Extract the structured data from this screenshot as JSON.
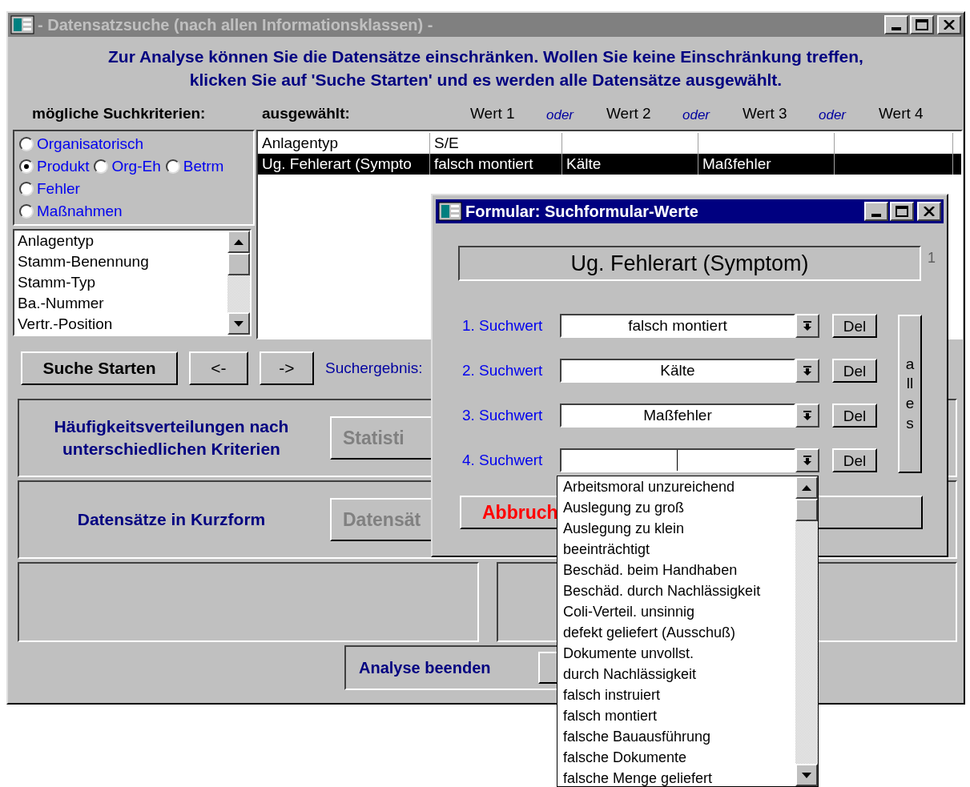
{
  "window": {
    "title": "- Datensatzsuche (nach allen Informationsklassen) -",
    "active": false
  },
  "instructions": [
    "Zur Analyse können Sie die Datensätze einschränken. Wollen Sie keine Einschränkung treffen,",
    "klicken Sie auf 'Suche Starten' und es werden alle Datensätze ausgewählt."
  ],
  "criteria_label": "mögliche Suchkriterien:",
  "selected_label": "ausgewählt:",
  "value_headers": [
    {
      "text": "Wert 1",
      "kind": "value"
    },
    {
      "text": "oder",
      "kind": "connector"
    },
    {
      "text": "Wert 2",
      "kind": "value"
    },
    {
      "text": "oder",
      "kind": "connector"
    },
    {
      "text": "Wert 3",
      "kind": "value"
    },
    {
      "text": "oder",
      "kind": "connector"
    },
    {
      "text": "Wert 4",
      "kind": "value"
    }
  ],
  "categories": [
    [
      {
        "label": "Organisatorisch",
        "selected": false
      }
    ],
    [
      {
        "label": "Produkt",
        "selected": true
      },
      {
        "label": "Org-Eh",
        "selected": false
      },
      {
        "label": "Betrm",
        "selected": false
      }
    ],
    [
      {
        "label": "Fehler",
        "selected": false
      }
    ],
    [
      {
        "label": "Maßnahmen",
        "selected": false
      }
    ]
  ],
  "fields_list": {
    "items": [
      "Anlagentyp",
      "Stamm-Benennung",
      "Stamm-Typ",
      "Ba.-Nummer",
      "Vertr.-Position"
    ]
  },
  "selection_table": {
    "rows": [
      {
        "cells": [
          "Anlagentyp",
          "S/E",
          "",
          "",
          ""
        ],
        "selected": false
      },
      {
        "cells": [
          "Ug. Fehlerart (Sympto",
          "falsch montiert",
          "Kälte",
          "Maßfehler",
          ""
        ],
        "selected": true
      }
    ]
  },
  "buttons": [
    "Suche Starten",
    "<-",
    "->"
  ],
  "result_label": "Suchergebnis:",
  "panels": [
    {
      "text": "Häufigkeitsverteilungen nach unterschiedlichen Kriterien",
      "button": "Statisti"
    },
    {
      "text": "Datensätze in Kurzform",
      "button": "Datensät"
    }
  ],
  "finish": {
    "label": "Analyse beenden"
  },
  "dialog": {
    "title": "Formular: Suchformular-Werte",
    "active": true,
    "field_name": "Ug. Fehlerart (Symptom)",
    "counter": "1",
    "search_values": [
      {
        "label": "1. Suchwert",
        "value": "falsch montiert",
        "delete_button": "Del"
      },
      {
        "label": "2. Suchwert",
        "value": "Kälte",
        "delete_button": "Del"
      },
      {
        "label": "3. Suchwert",
        "value": "Maßfehler",
        "delete_button": "Del"
      },
      {
        "label": "4. Suchwert",
        "delete_button": "Del"
      }
    ],
    "all_button": "alles",
    "cancel_button": "Abbruch",
    "dropdown": {
      "items": [
        "Arbeitsmoral unzureichend",
        "Auslegung zu groß",
        "Auslegung zu klein",
        "beeinträchtigt",
        "Beschäd. beim Handhaben",
        "Beschäd. durch Nachlässigkeit",
        "Coli-Verteil. unsinnig",
        "defekt geliefert  (Ausschuß)",
        "Dokumente unvollst.",
        "durch Nachlässigkeit",
        "falsch instruiert",
        "falsch montiert",
        "falsche Bauausführung",
        "falsche Dokumente",
        "falsche Menge geliefert"
      ]
    }
  }
}
